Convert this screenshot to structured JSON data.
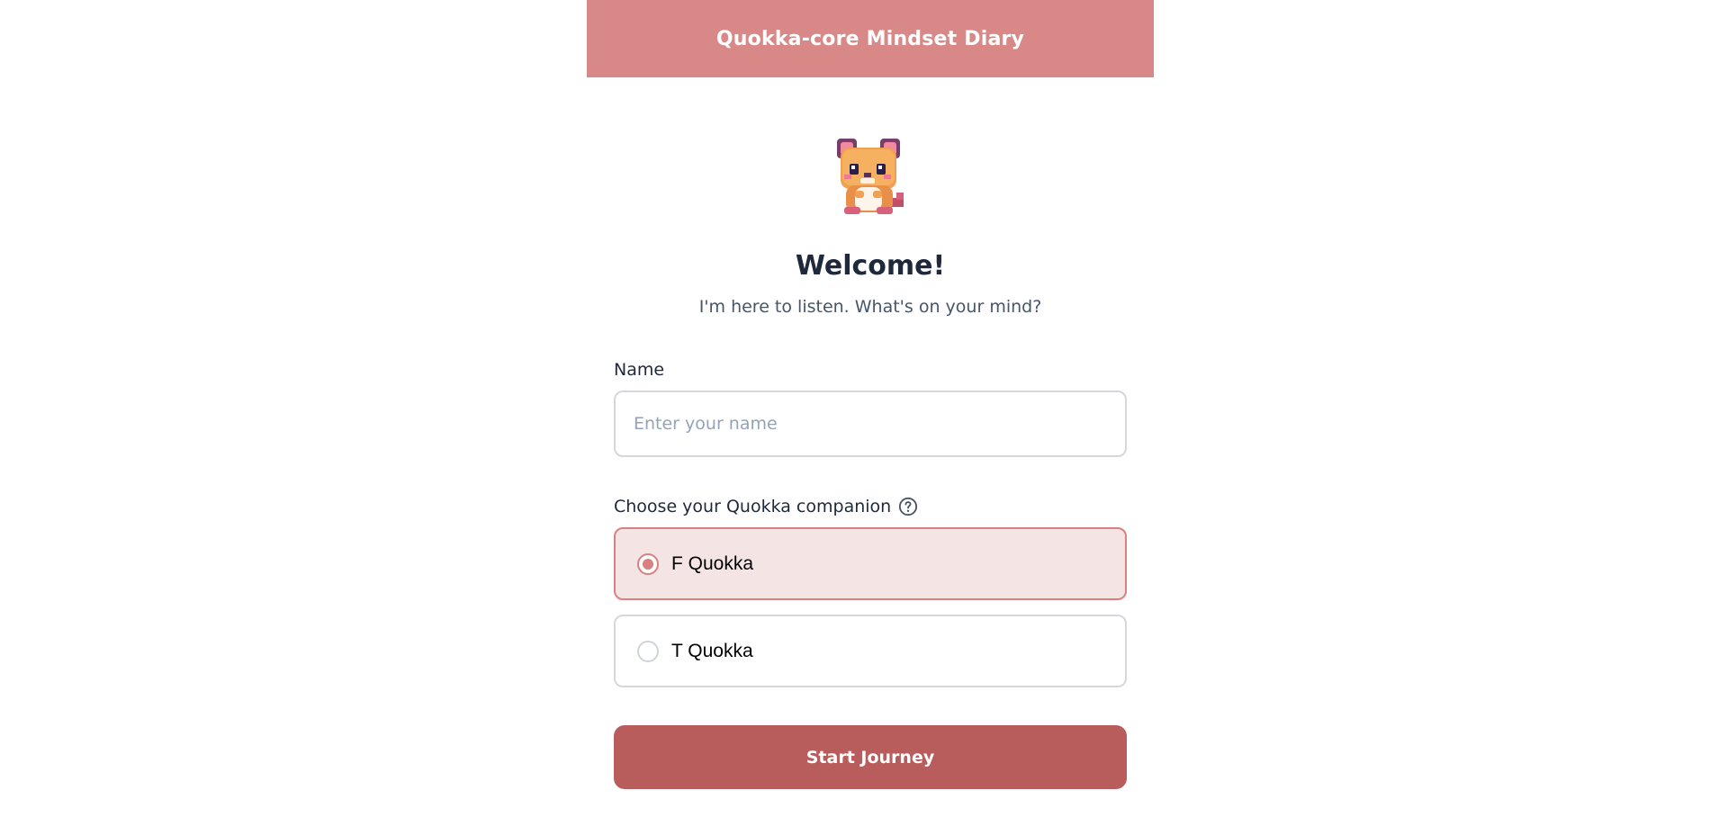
{
  "header": {
    "title": "Quokka-core Mindset Diary"
  },
  "mascot": {
    "icon": "quokka-mascot-icon"
  },
  "welcome": {
    "title": "Welcome!",
    "subtitle": "I'm here to listen. What's on your mind?"
  },
  "form": {
    "name_label": "Name",
    "name_value": "",
    "name_placeholder": "Enter your name",
    "companion_label": "Choose your Quokka companion",
    "help_icon": "question-circle-icon",
    "companions": [
      {
        "label": "F Quokka",
        "selected": true
      },
      {
        "label": "T Quokka",
        "selected": false
      }
    ],
    "submit_label": "Start Journey"
  },
  "colors": {
    "header_bg": "#d98888",
    "accent": "#d98080",
    "selected_bg": "#f5e4e4",
    "button_bg": "#b85c5c"
  }
}
